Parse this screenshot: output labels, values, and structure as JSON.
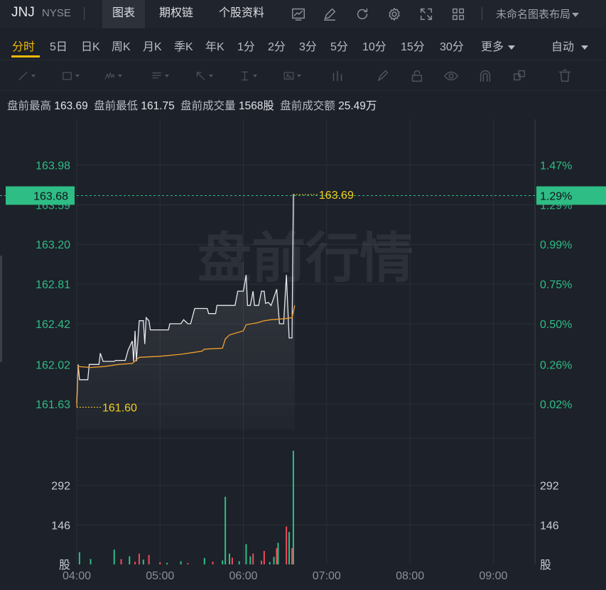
{
  "header": {
    "symbol": "JNJ",
    "exchange": "NYSE",
    "tabs": [
      {
        "label": "图表",
        "active": true
      },
      {
        "label": "期权链",
        "active": false
      },
      {
        "label": "个股资料",
        "active": false
      }
    ],
    "layout_label": "未命名图表布局",
    "icons": [
      "chart-line-icon",
      "pencil-icon",
      "refresh-icon",
      "gear-icon",
      "fullscreen-icon",
      "grid-icon"
    ]
  },
  "periods": {
    "items": [
      "分时",
      "5日",
      "日K",
      "周K",
      "月K",
      "季K",
      "年K",
      "1分",
      "2分",
      "3分",
      "5分",
      "10分",
      "15分",
      "30分",
      "更多"
    ],
    "active": "分时",
    "adjust": "自动"
  },
  "drawing_tools": [
    "trend-line-icon",
    "rectangle-icon",
    "wave-icon",
    "text-list-icon",
    "arrow-icon",
    "measure-icon",
    "text-box-icon",
    "bar-chart-icon",
    "brush-icon",
    "lock-icon",
    "eye-icon",
    "magnet-icon",
    "layers-icon",
    "trash-icon"
  ],
  "info": {
    "high_label": "盘前最高",
    "high": "163.69",
    "low_label": "盘前最低",
    "low": "161.75",
    "volume_label": "盘前成交量",
    "volume": "1568股",
    "turnover_label": "盘前成交额",
    "turnover": "25.49万"
  },
  "colors": {
    "up": "#2ebd85",
    "down": "#f04a5b",
    "price_line": "#e6e8ec",
    "avg_line": "#f0a030",
    "highlight_label": "#f0d020",
    "current_tag": "#2ebd85"
  },
  "chart_data": {
    "type": "line",
    "watermark": "盘前行情",
    "x_ticks": [
      "04:00",
      "05:00",
      "06:00",
      "07:00",
      "08:00",
      "09:00"
    ],
    "x_range": [
      "04:00",
      "09:30"
    ],
    "price_axis": {
      "ticks": [
        "163.98",
        "163.59",
        "163.20",
        "162.81",
        "162.42",
        "162.02",
        "161.63"
      ],
      "ylim": [
        161.38,
        164.43
      ],
      "current": "163.68"
    },
    "pct_axis": {
      "ticks": [
        "1.47%",
        "1.29%",
        "0.99%",
        "0.75%",
        "0.50%",
        "0.26%",
        "0.02%"
      ],
      "current": "1.29%"
    },
    "annotations": {
      "high": "163.69",
      "low": "161.60"
    },
    "volume_axis": {
      "ticks": [
        "292",
        "146"
      ],
      "unit": "股",
      "ylim": [
        0,
        438
      ]
    },
    "price_series": [
      [
        "04:00",
        161.64
      ],
      [
        "04:01",
        162.02
      ],
      [
        "04:02",
        161.87
      ],
      [
        "04:08",
        161.87
      ],
      [
        "04:09",
        162.02
      ],
      [
        "04:16",
        162.02
      ],
      [
        "04:17",
        162.13
      ],
      [
        "04:19",
        162.05
      ],
      [
        "04:27",
        162.05
      ],
      [
        "04:28",
        162.06
      ],
      [
        "04:35",
        162.06
      ],
      [
        "04:37",
        162.16
      ],
      [
        "04:40",
        162.25
      ],
      [
        "04:41",
        162.05
      ],
      [
        "04:42",
        162.35
      ],
      [
        "04:43",
        162.05
      ],
      [
        "04:45",
        162.45
      ],
      [
        "04:48",
        162.45
      ],
      [
        "04:49",
        162.22
      ],
      [
        "04:50",
        162.48
      ],
      [
        "04:52",
        162.45
      ],
      [
        "04:53",
        162.36
      ],
      [
        "05:06",
        162.36
      ],
      [
        "05:07",
        162.42
      ],
      [
        "05:13",
        162.42
      ],
      [
        "05:15",
        162.42
      ],
      [
        "05:17",
        162.46
      ],
      [
        "05:20",
        162.42
      ],
      [
        "05:22",
        162.42
      ],
      [
        "05:25",
        162.57
      ],
      [
        "05:34",
        162.57
      ],
      [
        "05:35",
        162.52
      ],
      [
        "05:40",
        162.52
      ],
      [
        "05:41",
        162.6
      ],
      [
        "05:54",
        162.6
      ],
      [
        "05:56",
        162.74
      ],
      [
        "06:00",
        162.74
      ],
      [
        "06:02",
        162.9
      ],
      [
        "06:03",
        162.6
      ],
      [
        "06:05",
        162.6
      ],
      [
        "06:07",
        162.74
      ],
      [
        "06:08",
        162.6
      ],
      [
        "06:11",
        162.6
      ],
      [
        "06:13",
        162.74
      ],
      [
        "06:15",
        162.74
      ],
      [
        "06:16",
        162.62
      ],
      [
        "06:18",
        162.63
      ],
      [
        "06:20",
        162.6
      ],
      [
        "06:24",
        162.76
      ],
      [
        "06:26",
        162.42
      ],
      [
        "06:29",
        162.42
      ],
      [
        "06:31",
        162.9
      ],
      [
        "06:33",
        162.28
      ],
      [
        "06:35",
        162.28
      ],
      [
        "06:36",
        163.69
      ],
      [
        "06:37",
        163.69
      ]
    ],
    "avg_series": [
      [
        "04:00",
        161.6
      ],
      [
        "04:01",
        162.0
      ],
      [
        "04:10",
        161.99
      ],
      [
        "04:20",
        162.0
      ],
      [
        "04:30",
        162.02
      ],
      [
        "04:40",
        162.03
      ],
      [
        "04:45",
        162.09
      ],
      [
        "05:00",
        162.1
      ],
      [
        "05:15",
        162.12
      ],
      [
        "05:30",
        162.15
      ],
      [
        "05:32",
        162.17
      ],
      [
        "05:45",
        162.18
      ],
      [
        "05:47",
        162.27
      ],
      [
        "05:50",
        162.31
      ],
      [
        "05:55",
        162.33
      ],
      [
        "06:00",
        162.35
      ],
      [
        "06:02",
        162.41
      ],
      [
        "06:10",
        162.43
      ],
      [
        "06:15",
        162.45
      ],
      [
        "06:20",
        162.46
      ],
      [
        "06:30",
        162.47
      ],
      [
        "06:35",
        162.48
      ],
      [
        "06:37",
        162.6
      ]
    ],
    "volume_series": [
      [
        "04:02",
        45,
        "up"
      ],
      [
        "04:10",
        20,
        "up"
      ],
      [
        "04:27",
        55,
        "up"
      ],
      [
        "04:32",
        20,
        "down"
      ],
      [
        "04:38",
        30,
        "up"
      ],
      [
        "04:42",
        10,
        "down"
      ],
      [
        "04:45",
        40,
        "down"
      ],
      [
        "04:48",
        18,
        "up"
      ],
      [
        "04:52",
        35,
        "down"
      ],
      [
        "05:00",
        8,
        "down"
      ],
      [
        "05:05",
        6,
        "up"
      ],
      [
        "05:15",
        12,
        "up"
      ],
      [
        "05:20",
        5,
        "down"
      ],
      [
        "05:32",
        24,
        "up"
      ],
      [
        "05:38",
        10,
        "down"
      ],
      [
        "05:45",
        15,
        "up"
      ],
      [
        "05:47",
        250,
        "up"
      ],
      [
        "05:50",
        40,
        "up"
      ],
      [
        "05:52",
        25,
        "down"
      ],
      [
        "05:57",
        12,
        "up"
      ],
      [
        "06:02",
        75,
        "up"
      ],
      [
        "06:05",
        30,
        "up"
      ],
      [
        "06:07",
        40,
        "down"
      ],
      [
        "06:13",
        14,
        "down"
      ],
      [
        "06:15",
        50,
        "down"
      ],
      [
        "06:19",
        9,
        "up"
      ],
      [
        "06:22",
        28,
        "up"
      ],
      [
        "06:24",
        60,
        "down"
      ],
      [
        "06:25",
        80,
        "up"
      ],
      [
        "06:31",
        140,
        "down"
      ],
      [
        "06:33",
        120,
        "up"
      ],
      [
        "06:35",
        60,
        "down"
      ],
      [
        "06:36",
        420,
        "up"
      ]
    ]
  }
}
